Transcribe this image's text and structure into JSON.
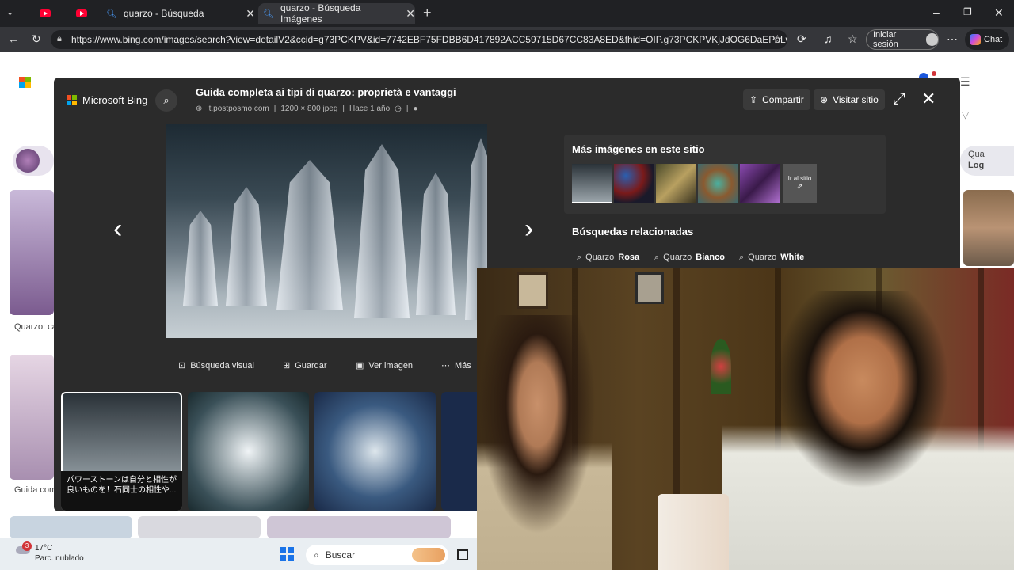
{
  "browser": {
    "tabs": [
      {
        "label": "",
        "favicon": "youtube-icon"
      },
      {
        "label": "",
        "favicon": "youtube-icon"
      },
      {
        "label": "quarzo - Búsqueda",
        "favicon": "bing-search-icon"
      },
      {
        "label": "quarzo - Búsqueda Imágenes",
        "favicon": "bing-search-icon",
        "active": true
      }
    ],
    "url": "https://www.bing.com/images/search?view=detailV2&ccid=g73PCKPV&id=7742EBF75FDBB6D417892ACC59715D67CC83A8ED&thid=OIP.g73PCKPVKjJdOG6DaEPoLwH...",
    "signin_label": "Iniciar sesión",
    "chat_label": "Chat"
  },
  "viewer": {
    "brand": "Microsoft Bing",
    "image_title": "Guida completa ai tipi di quarzo: proprietà e vantaggi",
    "source": "it.postposmo.com",
    "dimensions": "1200 × 800 jpeg",
    "age": "Hace 1 año",
    "share_label": "Compartir",
    "visit_label": "Visitar sitio",
    "more_images_title": "Más imágenes en este sitio",
    "go_to_site": "Ir al sitio",
    "related_title": "Búsquedas relacionadas",
    "related": [
      {
        "prefix": "Quarzo",
        "bold": "Rosa"
      },
      {
        "prefix": "Quarzo",
        "bold": "Bianco"
      },
      {
        "prefix": "Quarzo",
        "bold": "White"
      }
    ],
    "actions": {
      "visual_search": "Búsqueda visual",
      "save": "Guardar",
      "view_image": "Ver imagen",
      "more": "Más"
    },
    "strip_caption": "パワーストーンは自分と相性が良いものを！石同士の相性や..."
  },
  "background_page": {
    "captions": [
      "Quarzo: ca proprietà e",
      "Guida com vantaggi"
    ],
    "right_text": [
      "Qua",
      "Log"
    ]
  },
  "taskbar": {
    "temperature": "17°C",
    "weather": "Parc. nublado",
    "badge": "3",
    "search_label": "Buscar"
  },
  "colors": {
    "modal_bg": "#2b2b2b",
    "accent": "#0078d4",
    "tab_bar": "#202124"
  }
}
